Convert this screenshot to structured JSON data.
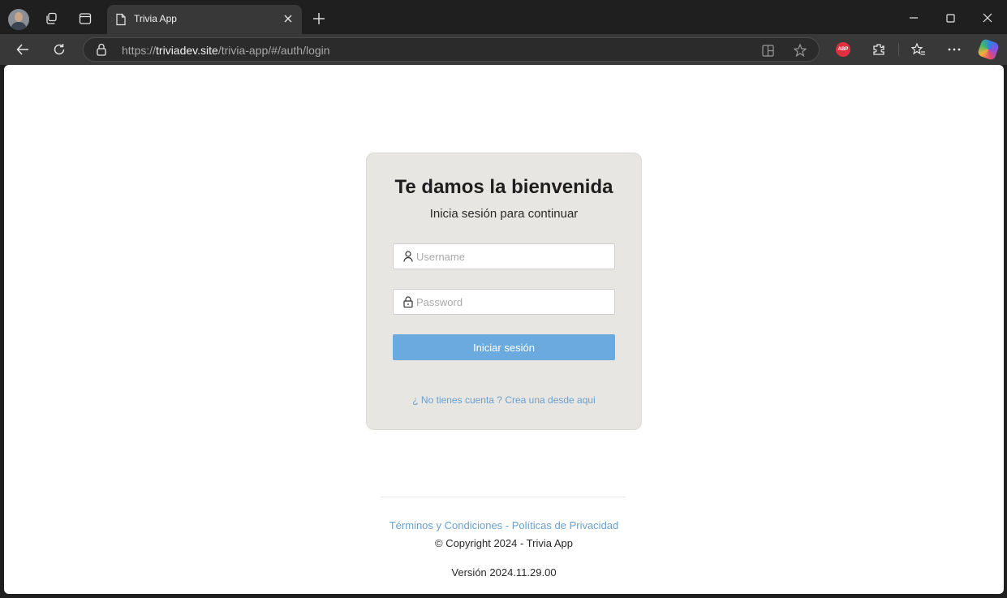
{
  "browser": {
    "tab_title": "Trivia App",
    "url_prefix": "https://",
    "url_domain": "triviadev.site",
    "url_path": "/trivia-app/#/auth/login",
    "extension_abp_label": "ABP",
    "icons": [
      "avatar",
      "workspaces-icon",
      "tab-actions-icon",
      "document-icon",
      "close-icon",
      "new-tab-icon",
      "minimize-icon",
      "maximize-icon",
      "window-close-icon",
      "back-icon",
      "refresh-icon",
      "lock-icon",
      "split-screen-icon",
      "favorite-star-icon",
      "extensions-icon",
      "favorites-icon",
      "more-icon",
      "copilot-icon"
    ]
  },
  "login": {
    "title": "Te damos la bienvenida",
    "subtitle": "Inicia sesión para continuar",
    "username_placeholder": "Username",
    "username_value": "",
    "password_placeholder": "Password",
    "password_value": "",
    "submit_label": "Iniciar sesión",
    "signup_link": "¿ No tienes cuenta ? Crea una desde aqui"
  },
  "footer": {
    "terms_link": "Términos y Condiciones",
    "links_separator": " - ",
    "privacy_link": "Políticas de Privacidad",
    "copyright": "© Copyright 2024 - Trivia App",
    "version": "Versión 2024.11.29.00"
  },
  "colors": {
    "card_background": "#e8e6e2",
    "button_background": "#6aaade",
    "link": "#6aa0cf",
    "browser_chrome": "#1f1f1f",
    "browser_toolbar": "#383838"
  }
}
